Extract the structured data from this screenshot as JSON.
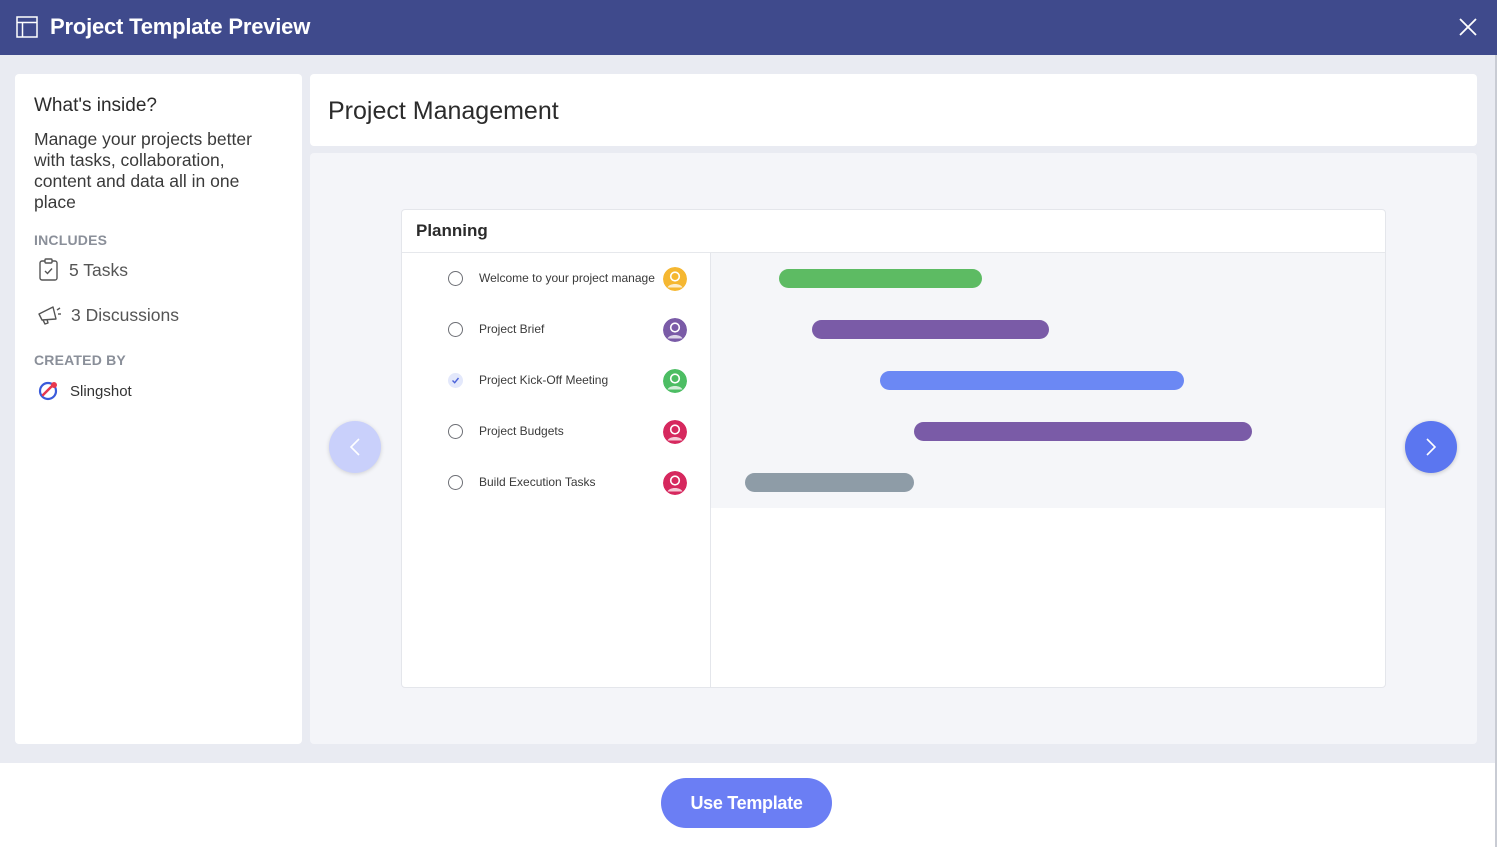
{
  "window": {
    "title": "Project Template Preview",
    "icon": "layout-panel-icon",
    "close_icon": "close-icon"
  },
  "sidebar": {
    "heading": "What's inside?",
    "description": "Manage your projects better with tasks, collaboration, content and data all in one place",
    "includes_label": "INCLUDES",
    "includes": [
      {
        "icon": "clipboard-check-icon",
        "label": "5 Tasks"
      },
      {
        "icon": "megaphone-icon",
        "label": "3 Discussions"
      }
    ],
    "created_by_label": "CREATED BY",
    "creator": {
      "icon": "slingshot-logo-icon",
      "name": "Slingshot"
    }
  },
  "main": {
    "title": "Project Management",
    "preview": {
      "board_title": "Planning",
      "tasks": [
        {
          "name": "Welcome to your project management",
          "checked": false,
          "avatar_color": "#f5b731",
          "bar_color": "#5dbb63",
          "bar_start": 0.1,
          "bar_end": 0.4
        },
        {
          "name": "Project Brief",
          "checked": false,
          "avatar_color": "#7a5ba7",
          "bar_color": "#7a5ba7",
          "bar_start": 0.15,
          "bar_end": 0.5
        },
        {
          "name": "Project Kick-Off Meeting",
          "checked": true,
          "avatar_color": "#4cbd63",
          "bar_color": "#6b88f4",
          "bar_start": 0.25,
          "bar_end": 0.7
        },
        {
          "name": "Project Budgets",
          "checked": false,
          "avatar_color": "#d6285e",
          "bar_color": "#7a5ba7",
          "bar_start": 0.3,
          "bar_end": 0.8
        },
        {
          "name": "Build Execution Tasks",
          "checked": false,
          "avatar_color": "#d6285e",
          "bar_color": "#8e9ca7",
          "bar_start": 0.05,
          "bar_end": 0.3
        }
      ],
      "prev_icon": "chevron-left-icon",
      "next_icon": "chevron-right-icon"
    }
  },
  "footer": {
    "use_template_label": "Use Template"
  }
}
